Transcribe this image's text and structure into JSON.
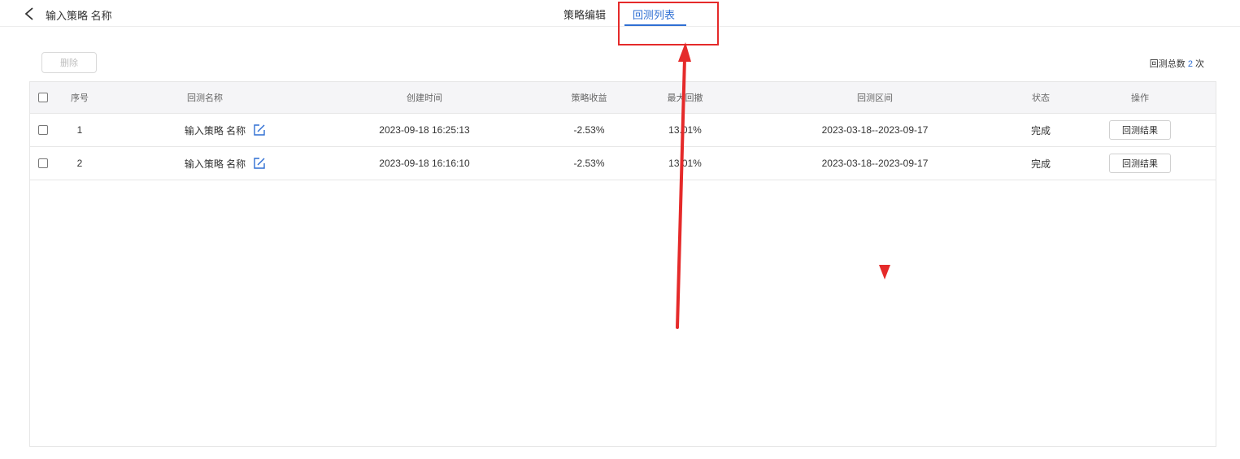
{
  "header": {
    "title": "输入策略 名称",
    "back_icon": "chevron-left-icon",
    "tabs": [
      {
        "label": "策略编辑",
        "active": false
      },
      {
        "label": "回测列表",
        "active": true
      }
    ]
  },
  "toolbar": {
    "delete_label": "删除",
    "total_prefix": "回测总数",
    "total_count": "2",
    "total_suffix": "次"
  },
  "table": {
    "columns": [
      "序号",
      "回测名称",
      "创建时间",
      "策略收益",
      "最大回撤",
      "回测区间",
      "状态",
      "操作"
    ],
    "rows": [
      {
        "index": "1",
        "name": "输入策略 名称",
        "created": "2023-09-18 16:25:13",
        "return": "-2.53%",
        "drawdown": "13.01%",
        "range": "2023-03-18--2023-09-17",
        "status": "完成",
        "action": "回测结果"
      },
      {
        "index": "2",
        "name": "输入策略 名称",
        "created": "2023-09-18 16:16:10",
        "return": "-2.53%",
        "drawdown": "13.01%",
        "range": "2023-03-18--2023-09-17",
        "status": "完成",
        "action": "回测结果"
      }
    ]
  },
  "colors": {
    "accent": "#2f6fd3",
    "annotation": "#e52a2a"
  }
}
